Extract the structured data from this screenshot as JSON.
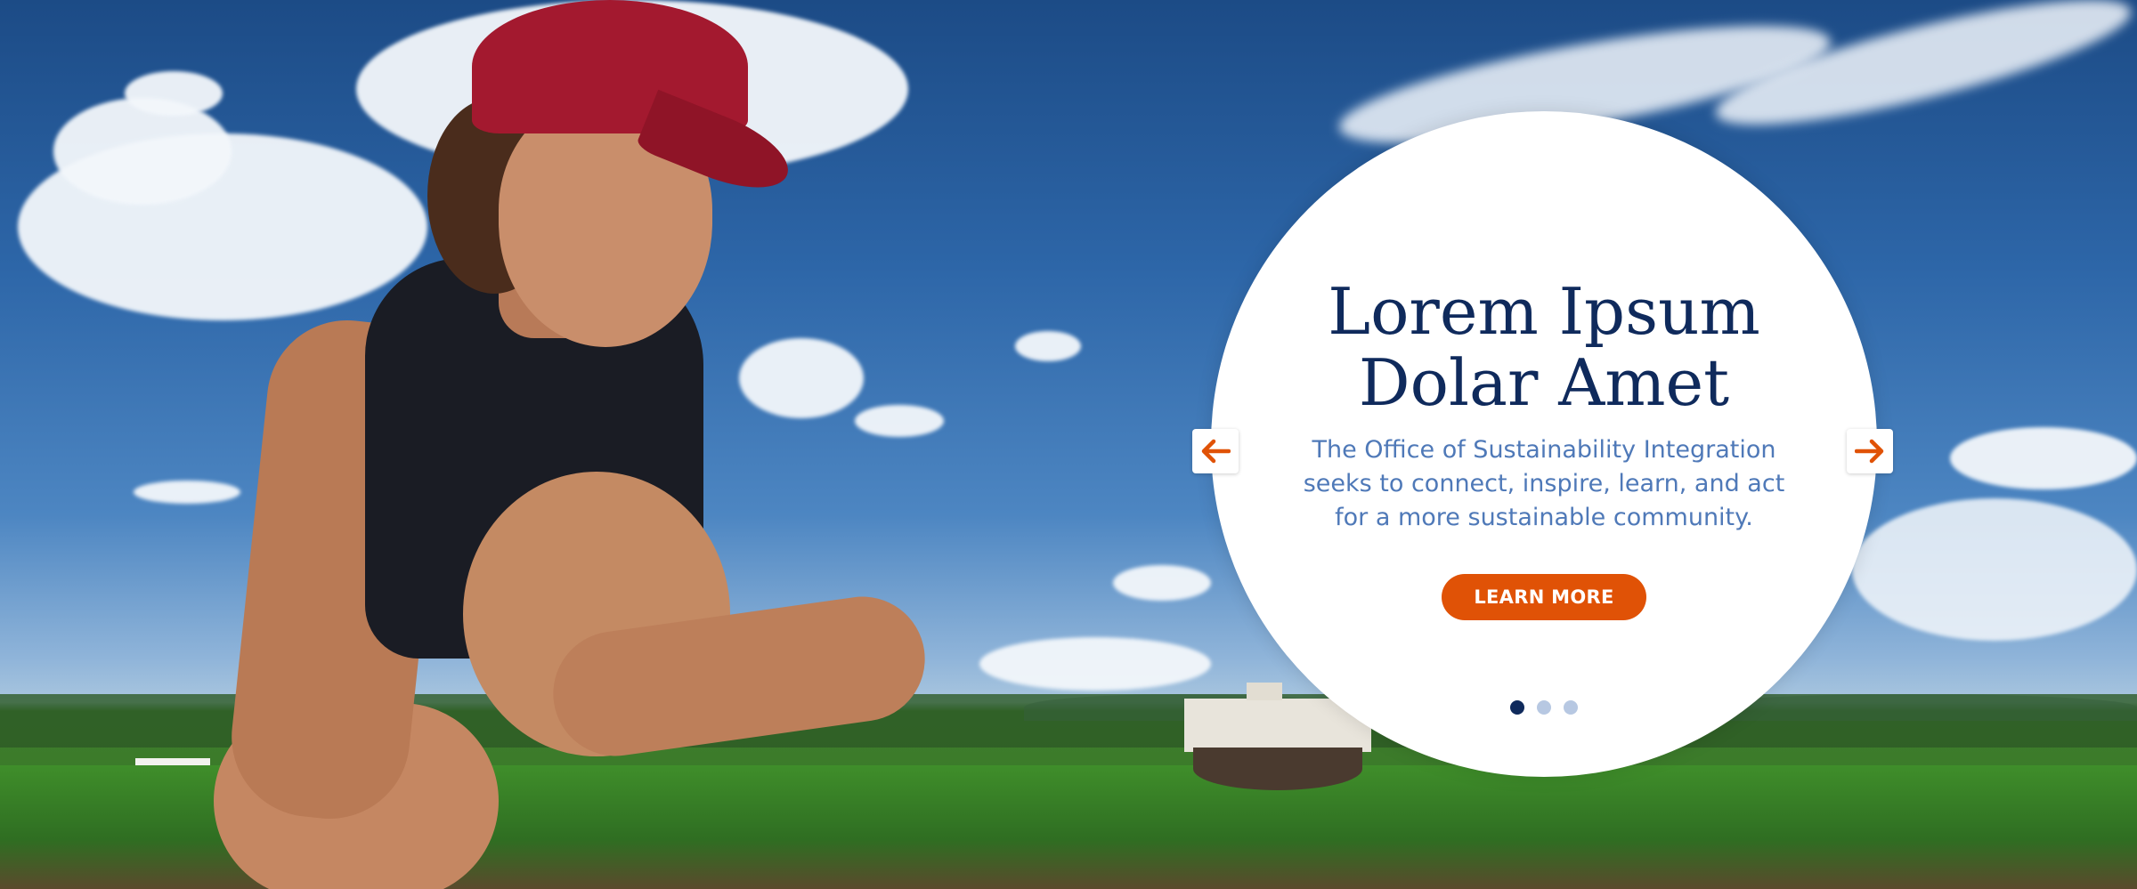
{
  "hero": {
    "title_line1": "Lorem Ipsum",
    "title_line2": "Dolar Amet",
    "description": "The Office of Sustainability Integration seeks to connect, inspire, learn, and act for a more sustainable community.",
    "button_label": "LEARN MORE"
  },
  "carousel": {
    "slides": 3,
    "active_slide": 1,
    "prev_icon": "arrow-left-icon",
    "next_icon": "arrow-right-icon"
  },
  "colors": {
    "title": "#0f2a5c",
    "description": "#4f79b8",
    "accent": "#e05206",
    "dot_active": "#0f2a5c",
    "dot_inactive": "#b7c8e2"
  }
}
